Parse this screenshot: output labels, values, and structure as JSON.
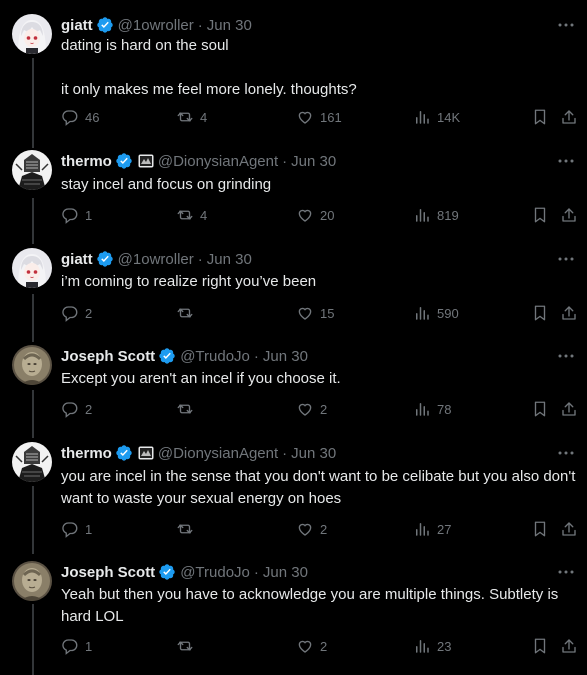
{
  "tweets": [
    {
      "name": "giatt",
      "handle": "@1owroller",
      "date": "Jun 30",
      "avatar": "anime-girl-avatar",
      "affiliate": false,
      "text": "dating is hard on the soul\n\nit only makes me feel more lonely. thoughts?",
      "replies": "46",
      "retweets": "4",
      "likes": "161",
      "views": "14K"
    },
    {
      "name": "thermo",
      "handle": "@DionysianAgent",
      "date": "Jun 30",
      "avatar": "sketch-warrior-avatar",
      "affiliate": true,
      "text": "stay incel and focus on grinding",
      "replies": "1",
      "retweets": "4",
      "likes": "20",
      "views": "819"
    },
    {
      "name": "giatt",
      "handle": "@1owroller",
      "date": "Jun 30",
      "avatar": "anime-girl-avatar",
      "affiliate": false,
      "text": "i’m coming to realize right you’ve been",
      "replies": "2",
      "retweets": "",
      "likes": "15",
      "views": "590"
    },
    {
      "name": "Joseph Scott",
      "handle": "@TrudoJo",
      "date": "Jun 30",
      "avatar": "portrait-avatar",
      "affiliate": false,
      "text": "Except you aren't an incel if you choose it.",
      "replies": "2",
      "retweets": "",
      "likes": "2",
      "views": "78"
    },
    {
      "name": "thermo",
      "handle": "@DionysianAgent",
      "date": "Jun 30",
      "avatar": "sketch-warrior-avatar",
      "affiliate": true,
      "text": "you are incel in the sense that you don't want to be celibate but you also don't want to waste your sexual energy on hoes",
      "replies": "1",
      "retweets": "",
      "likes": "2",
      "views": "27"
    },
    {
      "name": "Joseph Scott",
      "handle": "@TrudoJo",
      "date": "Jun 30",
      "avatar": "portrait-avatar",
      "affiliate": false,
      "text": "Yeah but then you have to acknowledge you are multiple things. Subtlety is hard LOL",
      "replies": "1",
      "retweets": "",
      "likes": "2",
      "views": "23"
    }
  ],
  "colors": {
    "background": "#000000",
    "text": "#e7e9ea",
    "secondary": "#71767b",
    "verified": "#1d9bf0",
    "thread_line": "#333639"
  }
}
